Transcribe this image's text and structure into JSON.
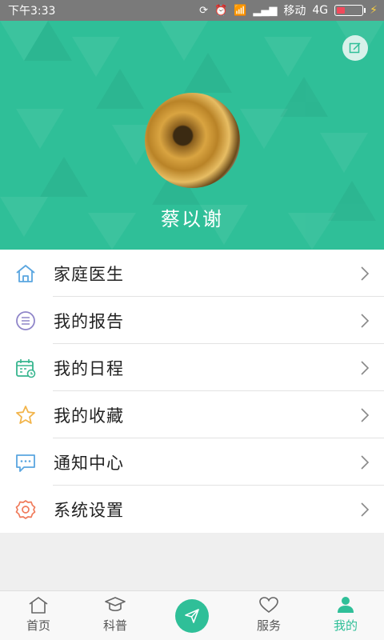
{
  "status_bar": {
    "time": "下午3:33",
    "carrier": "移动",
    "network": "4G"
  },
  "profile": {
    "username": "蔡以谢",
    "edit_icon": "edit-icon"
  },
  "menu": {
    "items": [
      {
        "label": "家庭医生",
        "icon": "home-icon",
        "color": "#5aa6e0"
      },
      {
        "label": "我的报告",
        "icon": "report-icon",
        "color": "#8f85c9"
      },
      {
        "label": "我的日程",
        "icon": "calendar-icon",
        "color": "#36b58e"
      },
      {
        "label": "我的收藏",
        "icon": "star-icon",
        "color": "#f2b44a"
      },
      {
        "label": "通知中心",
        "icon": "message-icon",
        "color": "#5aa6e0"
      },
      {
        "label": "系统设置",
        "icon": "settings-icon",
        "color": "#f07a5a"
      }
    ]
  },
  "bottom_nav": {
    "items": [
      {
        "label": "首页",
        "icon": "home-icon"
      },
      {
        "label": "科普",
        "icon": "graduation-cap-icon"
      },
      {
        "label": "",
        "icon": "send-icon"
      },
      {
        "label": "服务",
        "icon": "heart-icon"
      },
      {
        "label": "我的",
        "icon": "user-icon",
        "active": true
      }
    ]
  },
  "colors": {
    "primary": "#2fbf98",
    "status_bar": "#7a7a7a"
  }
}
